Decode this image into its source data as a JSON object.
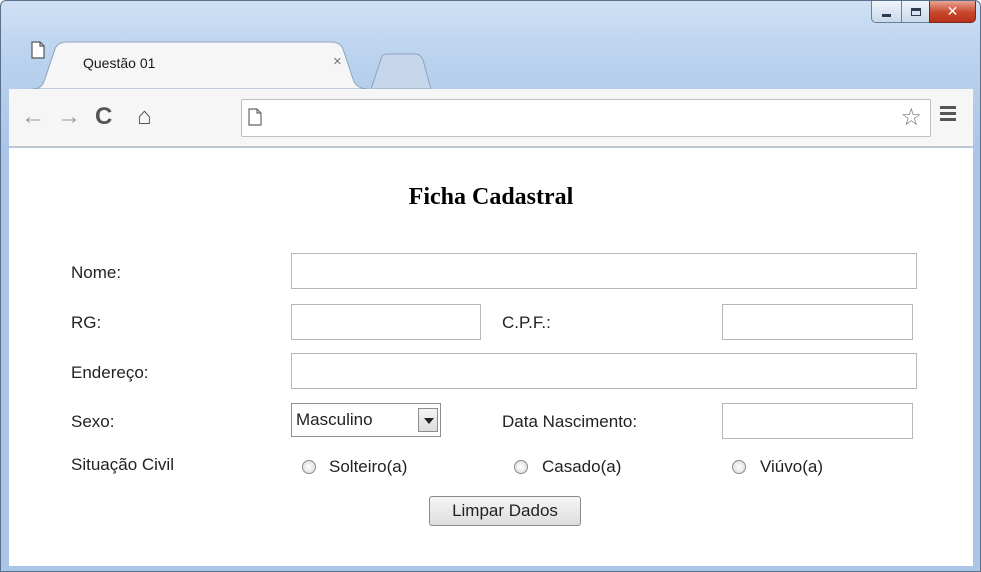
{
  "browser": {
    "tab_title": "Questão 01",
    "tab_close": "×",
    "address_value": ""
  },
  "icons": {
    "back": "←",
    "forward": "→",
    "reload": "C",
    "home": "⌂",
    "star": "☆"
  },
  "form": {
    "title": "Ficha Cadastral",
    "labels": {
      "nome": "Nome:",
      "rg": "RG:",
      "cpf": "C.P.F.:",
      "endereco": "Endereço:",
      "sexo": "Sexo:",
      "data_nascimento": "Data Nascimento:",
      "situacao_civil": "Situação Civil"
    },
    "values": {
      "nome": "",
      "rg": "",
      "cpf": "",
      "endereco": "",
      "data_nascimento": ""
    },
    "sexo_selected": "Masculino",
    "situacao_options": [
      "Solteiro(a)",
      "Casado(a)",
      "Viúvo(a)"
    ],
    "clear_button": "Limpar Dados"
  },
  "colors": {
    "window_frame": "#b9d2ee",
    "close_button": "#c7462b",
    "toolbar": "#f6f6f6"
  }
}
